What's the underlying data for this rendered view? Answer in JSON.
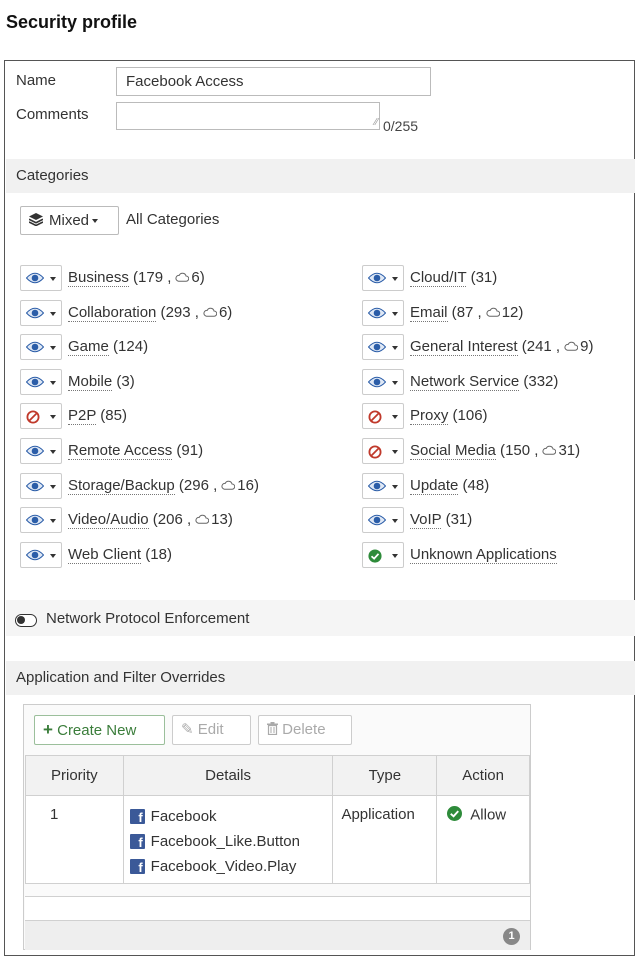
{
  "page": {
    "title": "Security profile"
  },
  "form": {
    "name_label": "Name",
    "name_value": "Facebook Access",
    "comments_label": "Comments",
    "comments_value": "",
    "comments_counter": "0/255"
  },
  "categories": {
    "section_label": "Categories",
    "mixed_label": "Mixed",
    "all_label": "All Categories",
    "left": [
      {
        "name": "Business",
        "count": "179",
        "cloud": "6",
        "action": "monitor"
      },
      {
        "name": "Collaboration",
        "count": "293",
        "cloud": "6",
        "action": "monitor"
      },
      {
        "name": "Game",
        "count": "124",
        "cloud": "",
        "action": "monitor"
      },
      {
        "name": "Mobile",
        "count": "3",
        "cloud": "",
        "action": "monitor"
      },
      {
        "name": "P2P",
        "count": "85",
        "cloud": "",
        "action": "block"
      },
      {
        "name": "Remote Access",
        "count": "91",
        "cloud": "",
        "action": "monitor"
      },
      {
        "name": "Storage/Backup",
        "count": "296",
        "cloud": "16",
        "action": "monitor"
      },
      {
        "name": "Video/Audio",
        "count": "206",
        "cloud": "13",
        "action": "monitor"
      },
      {
        "name": "Web Client",
        "count": "18",
        "cloud": "",
        "action": "monitor"
      }
    ],
    "right": [
      {
        "name": "Cloud/IT",
        "count": "31",
        "cloud": "",
        "action": "monitor"
      },
      {
        "name": "Email",
        "count": "87",
        "cloud": "12",
        "action": "monitor"
      },
      {
        "name": "General Interest",
        "count": "241",
        "cloud": "9",
        "action": "monitor"
      },
      {
        "name": "Network Service",
        "count": "332",
        "cloud": "",
        "action": "monitor"
      },
      {
        "name": "Proxy",
        "count": "106",
        "cloud": "",
        "action": "block"
      },
      {
        "name": "Social Media",
        "count": "150",
        "cloud": "31",
        "action": "block"
      },
      {
        "name": "Update",
        "count": "48",
        "cloud": "",
        "action": "monitor"
      },
      {
        "name": "VoIP",
        "count": "31",
        "cloud": "",
        "action": "monitor"
      },
      {
        "name": "Unknown Applications",
        "count": "",
        "cloud": "",
        "action": "allow"
      }
    ]
  },
  "protocol": {
    "label": "Network Protocol Enforcement",
    "enabled": false
  },
  "overrides": {
    "section_label": "Application and Filter Overrides",
    "toolbar": {
      "create_label": "Create New",
      "edit_label": "Edit",
      "delete_label": "Delete"
    },
    "columns": {
      "priority": "Priority",
      "details": "Details",
      "type": "Type",
      "action": "Action"
    },
    "rows": [
      {
        "priority": "1",
        "details": [
          "Facebook",
          "Facebook_Like.Button",
          "Facebook_Video.Play"
        ],
        "type": "Application",
        "action": "Allow"
      }
    ],
    "footer_count": "1"
  },
  "colors": {
    "monitor": "#2b5da8",
    "block": "#c0392b",
    "allow": "#2e8b3a",
    "create": "#3a7d3a",
    "facebook": "#3b5998"
  },
  "icons": {
    "monitor": "eye-icon",
    "block": "block-icon",
    "allow": "check-circle-icon",
    "mixed": "layers-icon",
    "cloud": "cloud-icon",
    "facebook": "facebook-icon"
  }
}
